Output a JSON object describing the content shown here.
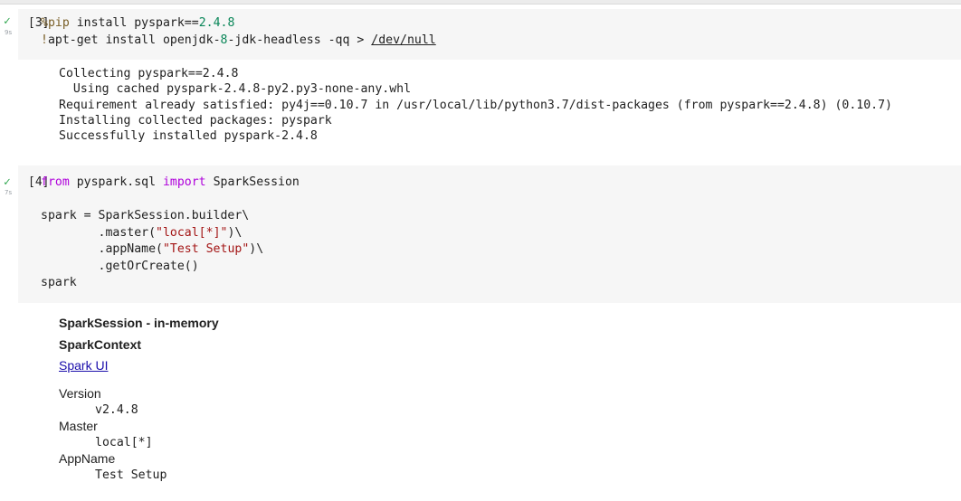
{
  "cells": [
    {
      "exec_label": "[3]",
      "duration": "9s",
      "code_lines": [
        "%pip install pyspark==2.4.8",
        "!apt-get install openjdk-8-jdk-headless -qq > /dev/null"
      ],
      "output_lines": [
        "Collecting pyspark==2.4.8",
        "  Using cached pyspark-2.4.8-py2.py3-none-any.whl",
        "Requirement already satisfied: py4j==0.10.7 in /usr/local/lib/python3.7/dist-packages (from pyspark==2.4.8) (0.10.7)",
        "Installing collected packages: pyspark",
        "Successfully installed pyspark-2.4.8"
      ]
    },
    {
      "exec_label": "[4]",
      "duration": "7s",
      "code_lines": [
        "from pyspark.sql import SparkSession",
        "",
        "spark = SparkSession.builder\\",
        "        .master(\"local[*]\")\\",
        "        .appName(\"Test Setup\")\\",
        "        .getOrCreate()",
        "spark"
      ],
      "output": {
        "title": "SparkSession - in-memory",
        "context_title": "SparkContext",
        "link_label": "Spark UI",
        "fields": [
          {
            "label": "Version",
            "value": "v2.4.8"
          },
          {
            "label": "Master",
            "value": "local[*]"
          },
          {
            "label": "AppName",
            "value": "Test Setup"
          }
        ]
      }
    }
  ],
  "status_icon": "check-icon",
  "colors": {
    "check": "#34a853",
    "editor_bg": "#f6f6f6",
    "keyword": "#af00db",
    "magic": "#795e26",
    "number": "#098658",
    "string": "#a31515",
    "link": "#1a0dab"
  }
}
